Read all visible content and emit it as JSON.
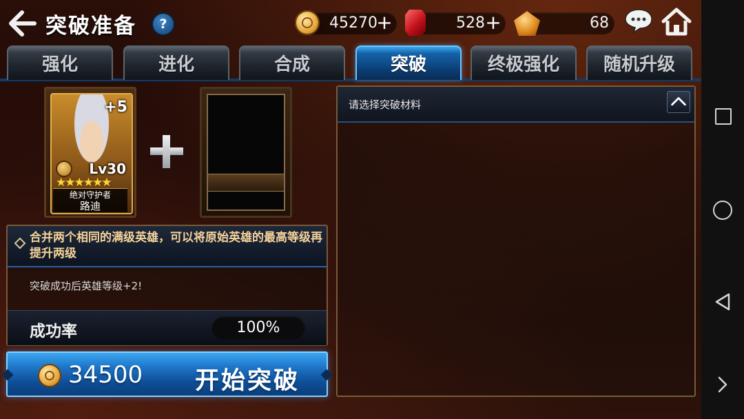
{
  "header": {
    "title": "突破准备",
    "help_label": "?",
    "gold": "45270",
    "ruby": "528",
    "amber": "68",
    "plus_label": "+"
  },
  "tabs": [
    {
      "label": "强化"
    },
    {
      "label": "进化"
    },
    {
      "label": "合成"
    },
    {
      "label": "突破"
    },
    {
      "label": "终极强化"
    },
    {
      "label": "随机升级"
    }
  ],
  "active_tab": "突破",
  "hero": {
    "plus": "+5",
    "level": "Lv30",
    "stars": 6,
    "title": "绝对守护者",
    "name": "路迪"
  },
  "info": {
    "description": "合并两个相同的满级英雄，可以将原始英雄的最高等级再提升两级",
    "bonus": "突破成功后英雄等级+2!",
    "success_label": "成功率",
    "success_value": "100%"
  },
  "start": {
    "cost": "34500",
    "label": "开始突破"
  },
  "materials": {
    "title": "请选择突破材料"
  },
  "colors": {
    "accent_blue": "#1d73c6",
    "gold_text": "#f4d39a"
  },
  "icons": [
    "back-arrow-icon",
    "help-icon",
    "gold-coin-icon",
    "ruby-icon",
    "amber-gem-icon",
    "chat-icon",
    "home-icon",
    "shield-icon",
    "plus-icon",
    "chevron-up-icon"
  ]
}
